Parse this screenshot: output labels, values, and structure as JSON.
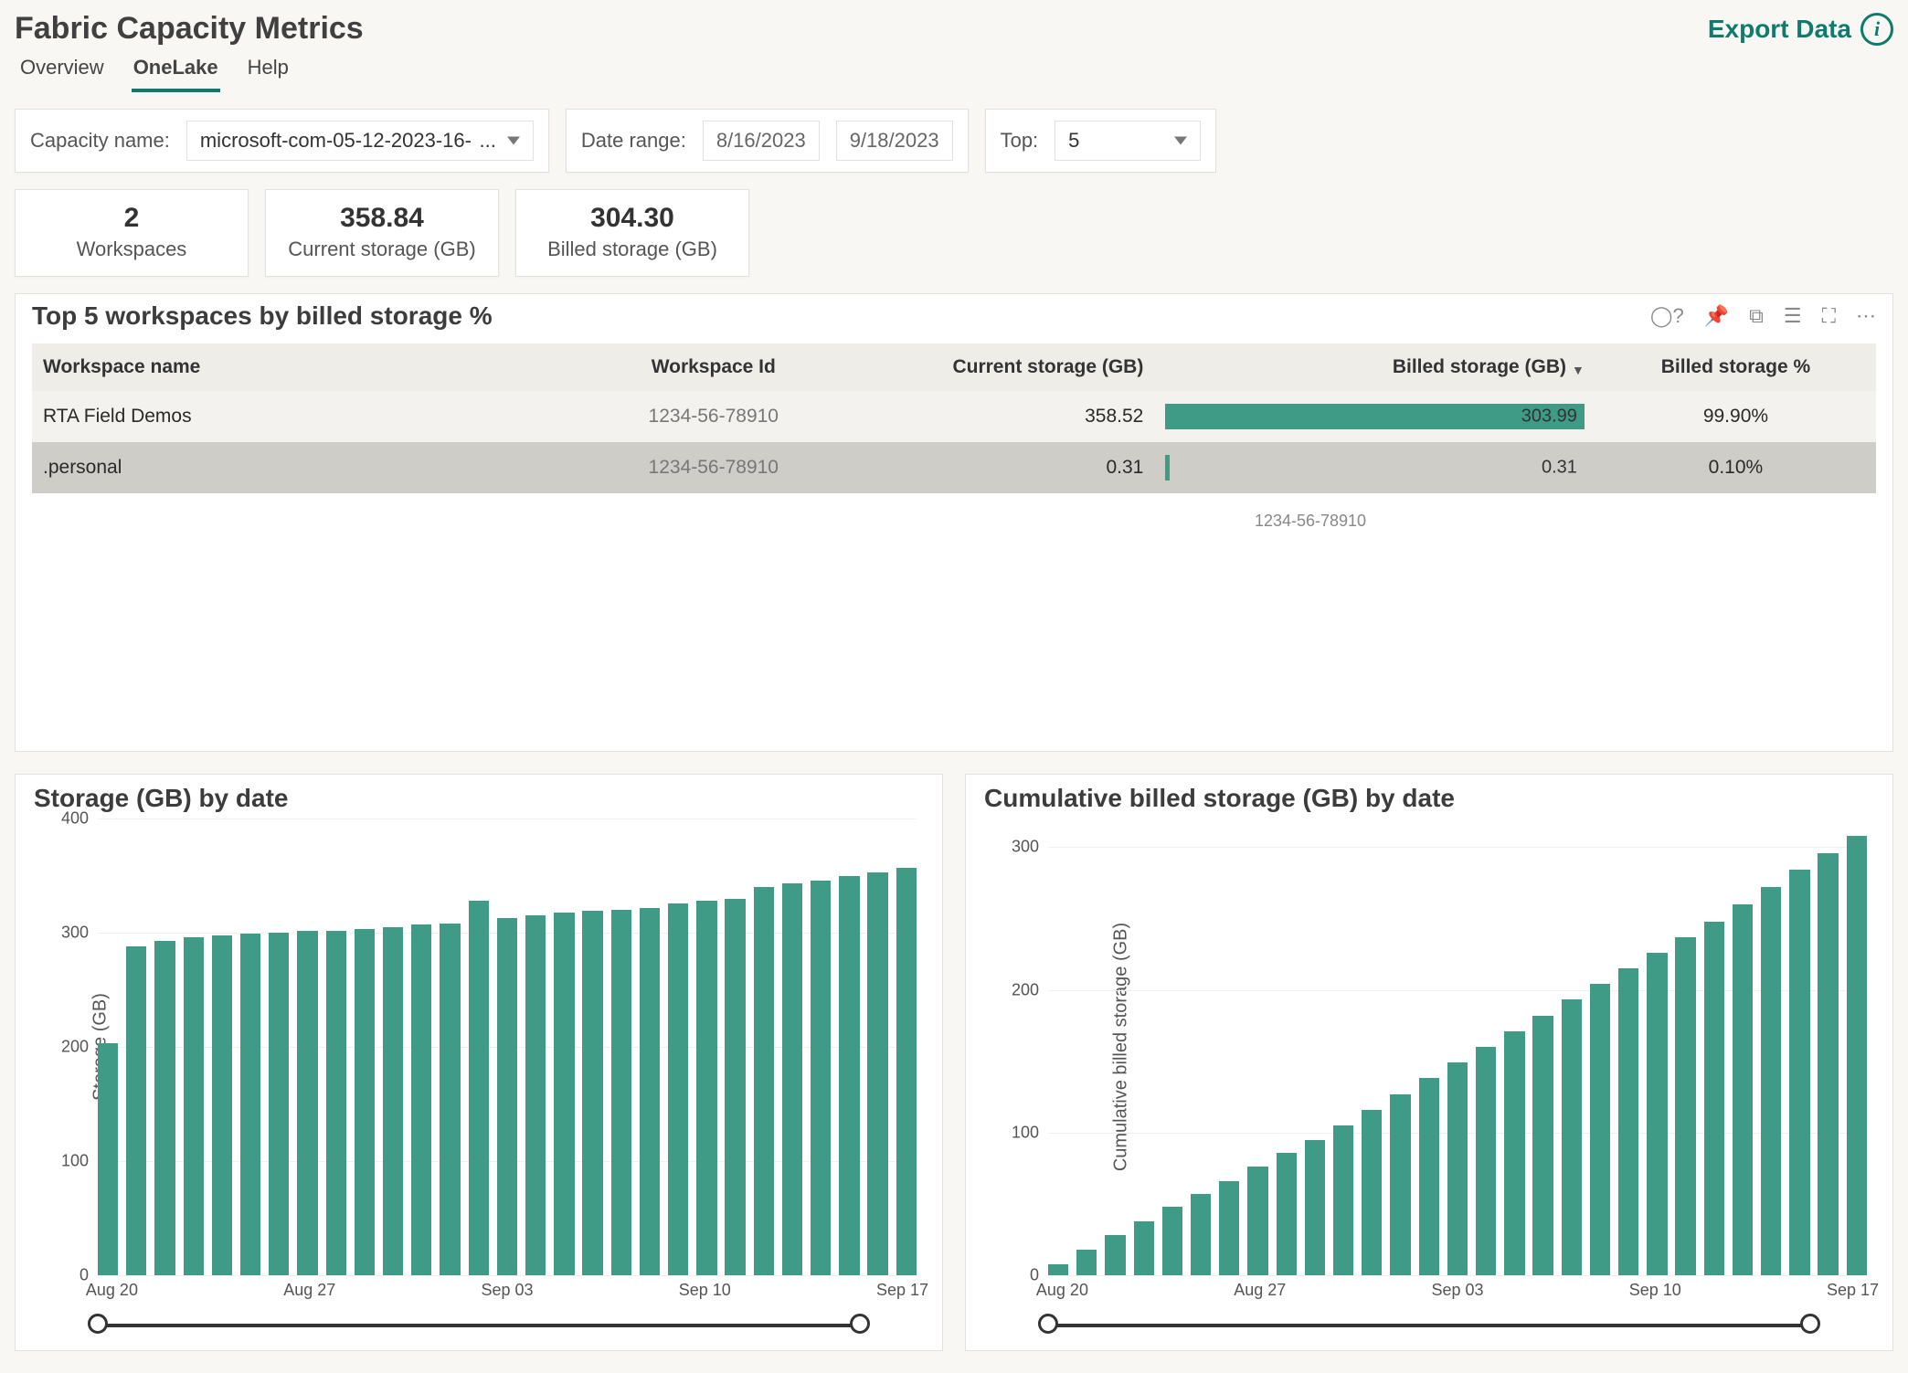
{
  "header": {
    "title": "Fabric Capacity Metrics",
    "export_label": "Export Data",
    "info_glyph": "i"
  },
  "tabs": [
    {
      "id": "overview",
      "label": "Overview",
      "active": false
    },
    {
      "id": "onelake",
      "label": "OneLake",
      "active": true
    },
    {
      "id": "help",
      "label": "Help",
      "active": false
    }
  ],
  "filters": {
    "capacity_label": "Capacity name:",
    "capacity_value": "microsoft-com-05-12-2023-16-",
    "capacity_suffix": "...",
    "date_label": "Date range:",
    "date_from": "8/16/2023",
    "date_to": "9/18/2023",
    "top_label": "Top:",
    "top_value": "5"
  },
  "kpis": [
    {
      "value": "2",
      "label": "Workspaces"
    },
    {
      "value": "358.84",
      "label": "Current storage (GB)"
    },
    {
      "value": "304.30",
      "label": "Billed storage (GB)"
    }
  ],
  "table": {
    "title": "Top 5 workspaces by billed storage %",
    "columns": [
      {
        "label": "Workspace name",
        "key": "name",
        "num": false
      },
      {
        "label": "Workspace Id",
        "key": "id",
        "num": false
      },
      {
        "label": "Current storage (GB)",
        "key": "cur",
        "num": true
      },
      {
        "label": "Billed storage (GB)",
        "key": "billed",
        "num": true,
        "sort": true,
        "bar": true
      },
      {
        "label": "Billed storage %",
        "key": "pct",
        "num": true
      }
    ],
    "rows": [
      {
        "name": "RTA Field Demos",
        "id": "1234-56-78910",
        "cur": "358.52",
        "billed": "303.99",
        "billed_bar_pct": 100,
        "pct": "99.90%"
      },
      {
        "name": ".personal",
        "id": "1234-56-78910",
        "cur": "0.31",
        "billed": "0.31",
        "billed_bar_pct": 1,
        "pct": "0.10%"
      }
    ],
    "footnote": "1234-56-78910",
    "toolbar_icons": [
      "help-circle-icon",
      "pin-icon",
      "copy-icon",
      "filter-icon",
      "focus-icon",
      "more-icon"
    ]
  },
  "chart_data": [
    {
      "type": "bar",
      "title": "Storage (GB) by date",
      "ylabel": "Storage (GB)",
      "ylim": [
        0,
        400
      ],
      "yticks": [
        0,
        100,
        200,
        300,
        400
      ],
      "categories": [
        "Aug 20",
        "Aug 21",
        "Aug 22",
        "Aug 23",
        "Aug 24",
        "Aug 25",
        "Aug 26",
        "Aug 27",
        "Aug 28",
        "Aug 29",
        "Aug 30",
        "Aug 31",
        "Sep 01",
        "Sep 02",
        "Sep 03",
        "Sep 04",
        "Sep 05",
        "Sep 06",
        "Sep 07",
        "Sep 08",
        "Sep 09",
        "Sep 10",
        "Sep 11",
        "Sep 12",
        "Sep 13",
        "Sep 14",
        "Sep 15",
        "Sep 16",
        "Sep 17"
      ],
      "xticks": [
        "Aug 20",
        "Aug 27",
        "Sep 03",
        "Sep 10",
        "Sep 17"
      ],
      "values": [
        203,
        288,
        293,
        296,
        298,
        299,
        300,
        302,
        302,
        303,
        305,
        307,
        308,
        328,
        313,
        315,
        318,
        319,
        320,
        322,
        326,
        328,
        330,
        340,
        343,
        346,
        350,
        353,
        357
      ]
    },
    {
      "type": "bar",
      "title": "Cumulative billed storage (GB) by date",
      "ylabel": "Cumulative billed storage (GB)",
      "ylim": [
        0,
        320
      ],
      "yticks": [
        0,
        100,
        200,
        300
      ],
      "categories": [
        "Aug 20",
        "Aug 21",
        "Aug 22",
        "Aug 23",
        "Aug 24",
        "Aug 25",
        "Aug 26",
        "Aug 27",
        "Aug 28",
        "Aug 29",
        "Aug 30",
        "Aug 31",
        "Sep 01",
        "Sep 02",
        "Sep 03",
        "Sep 04",
        "Sep 05",
        "Sep 06",
        "Sep 07",
        "Sep 08",
        "Sep 09",
        "Sep 10",
        "Sep 11",
        "Sep 12",
        "Sep 13",
        "Sep 14",
        "Sep 15",
        "Sep 16",
        "Sep 17"
      ],
      "xticks": [
        "Aug 20",
        "Aug 27",
        "Sep 03",
        "Sep 10",
        "Sep 17"
      ],
      "values": [
        8,
        18,
        28,
        38,
        48,
        57,
        66,
        76,
        86,
        95,
        105,
        116,
        127,
        138,
        149,
        160,
        171,
        182,
        193,
        204,
        215,
        226,
        237,
        248,
        260,
        272,
        284,
        296,
        308
      ]
    }
  ]
}
